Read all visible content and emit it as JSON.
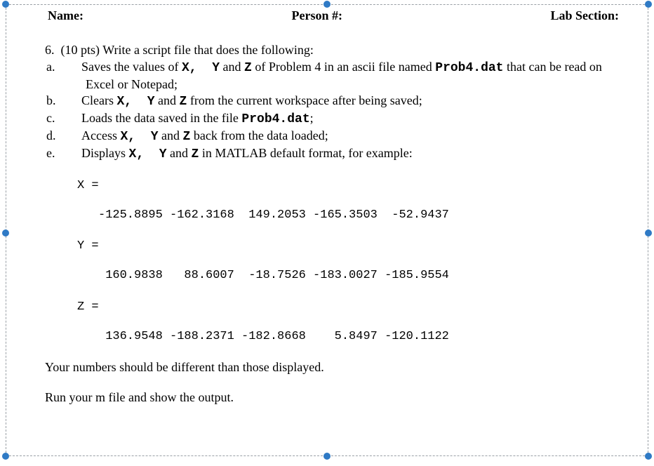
{
  "header": {
    "name_label": "Name:",
    "person_label": "Person #:",
    "lab_label": "Lab Section:"
  },
  "question": {
    "number": "6.",
    "points": "(10 pts)",
    "intro": "Write a script file that does the following:",
    "subs": {
      "a": {
        "marker": "a.",
        "pre": "Saves the values of ",
        "x": "X",
        "comma_space": ",",
        "space": " ",
        "y": "Y",
        "and": " and ",
        "z": "Z",
        "mid": " of Problem 4 in an ascii file named ",
        "file": "Prob4.dat",
        "post": " that can be read on Excel or Notepad;"
      },
      "b": {
        "marker": "b.",
        "pre": "Clears ",
        "x": "X",
        "comma_space": ",",
        "space": " ",
        "y": "Y",
        "and": " and ",
        "z": "Z",
        "post": " from the current workspace after being saved;"
      },
      "c": {
        "marker": "c.",
        "pre": "Loads the data saved in the file ",
        "file": "Prob4.dat",
        "post": ";"
      },
      "d": {
        "marker": "d.",
        "pre": "Access ",
        "x": "X",
        "comma_space": ",",
        "space": " ",
        "y": "Y",
        "and": " and ",
        "z": "Z",
        "post": " back from the data loaded;"
      },
      "e": {
        "marker": "e.",
        "pre": "Displays ",
        "x": "X",
        "comma_space": ",",
        "space": " ",
        "y": "Y",
        "and": " and ",
        "z": "Z",
        "post": " in MATLAB default format, for example:"
      }
    }
  },
  "output": {
    "x_label": "X =",
    "x_values": "-125.8895 -162.3168  149.2053 -165.3503  -52.9437",
    "y_label": "Y =",
    "y_values": " 160.9838   88.6007  -18.7526 -183.0027 -185.9554",
    "z_label": "Z =",
    "z_values": " 136.9548 -188.2371 -182.8668    5.8497 -120.1122"
  },
  "note": "Your numbers should be different than those displayed.",
  "run_note": "Run your m file and show the output."
}
